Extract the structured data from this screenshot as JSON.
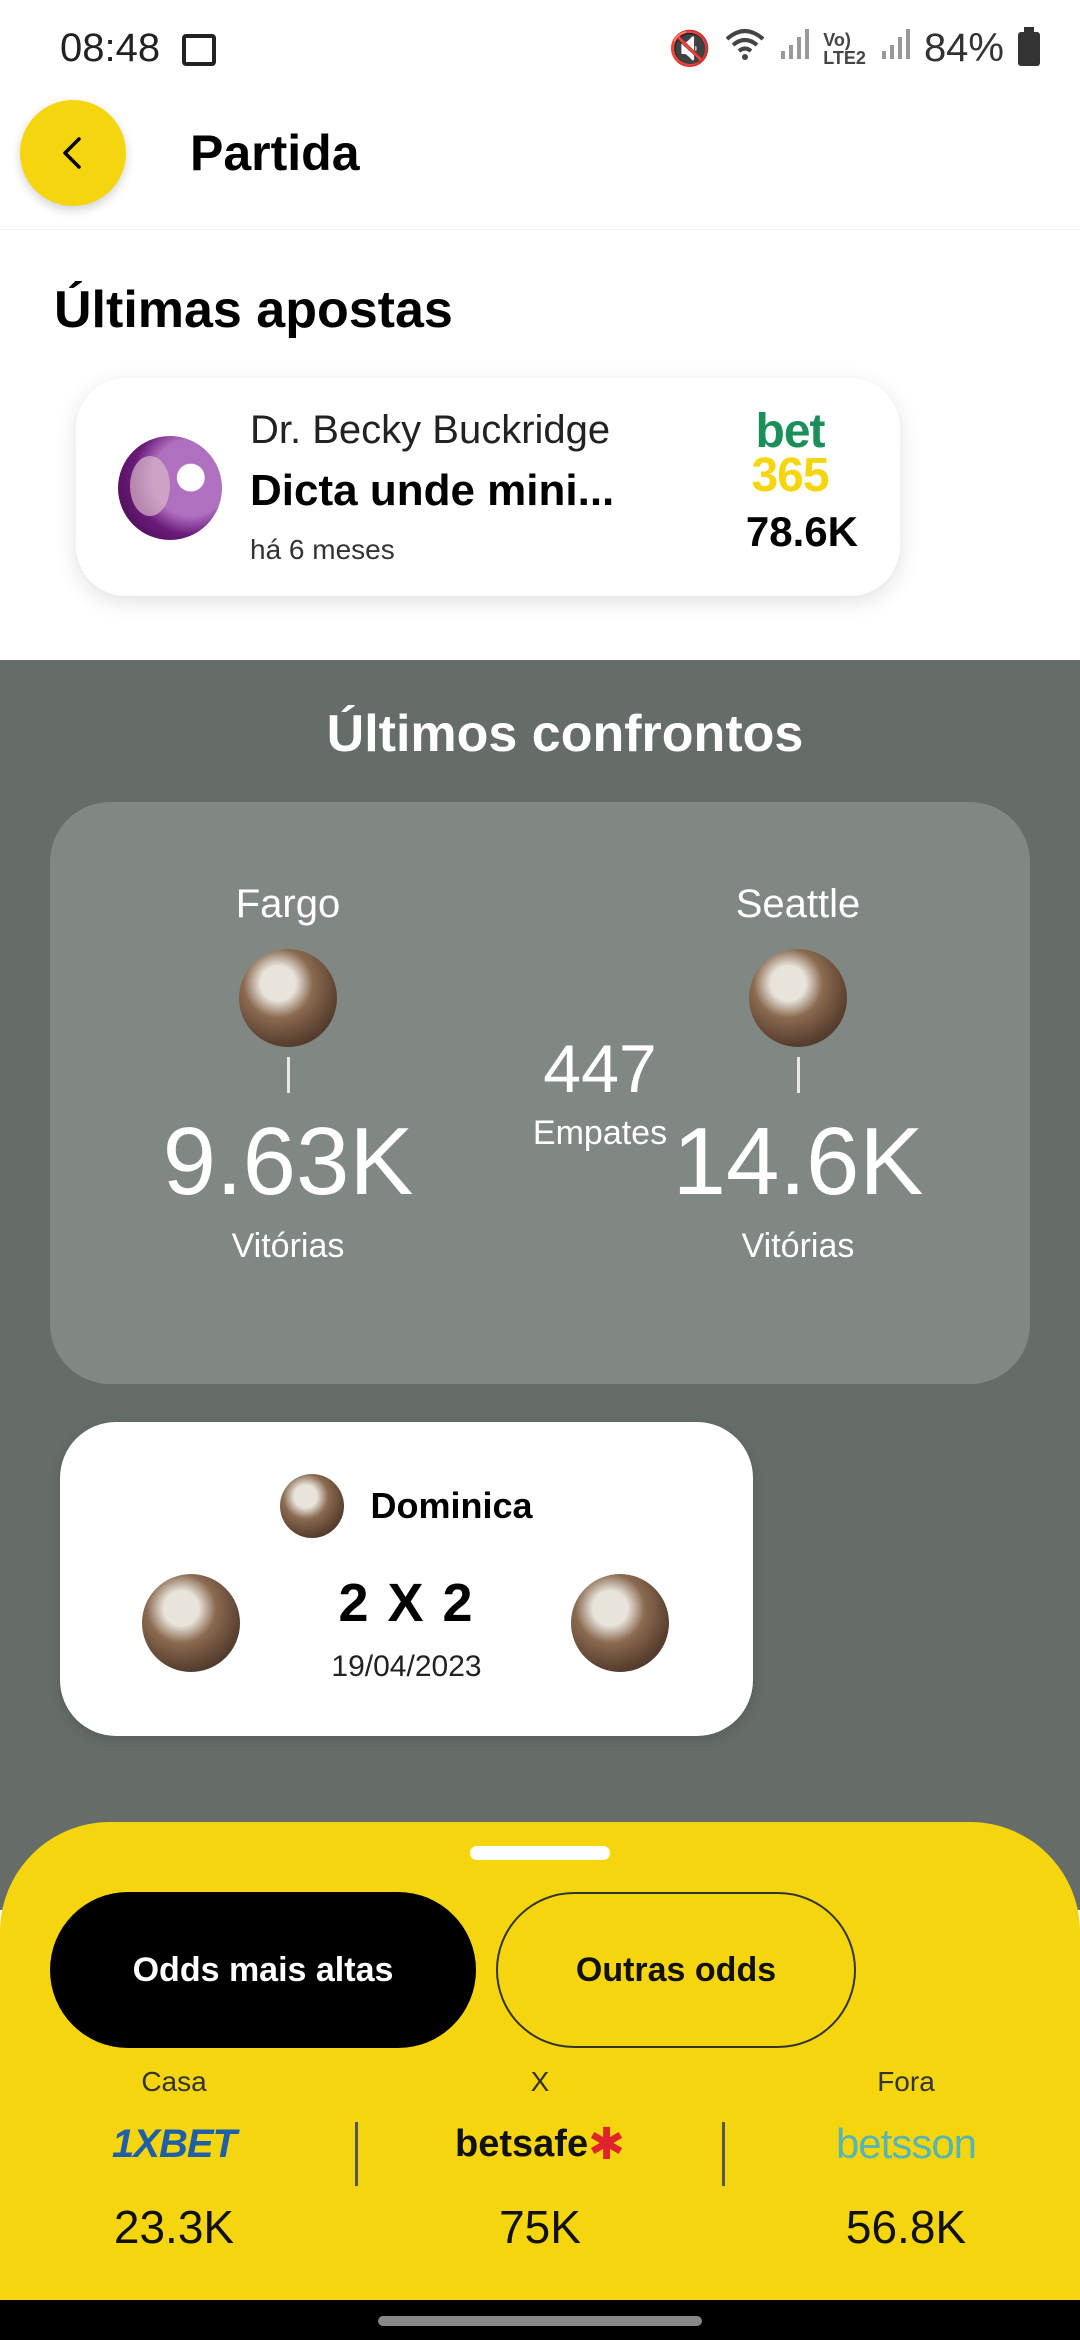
{
  "status_bar": {
    "time": "08:48",
    "battery": "84%",
    "icons": [
      "photo-icon",
      "mute-icon",
      "wifi-icon",
      "signal-icon",
      "volte-icon",
      "signal-icon",
      "battery-icon"
    ]
  },
  "header": {
    "title": "Partida",
    "back_icon": "chevron-left-icon"
  },
  "latest_bets": {
    "title": "Últimas apostas",
    "items": [
      {
        "user": "Dr. Becky Buckridge",
        "title": "Dicta unde mini...",
        "time": "há 6 meses",
        "bookmaker_line1": "bet",
        "bookmaker_line2": "365",
        "value": "78.6K"
      }
    ]
  },
  "confrontations": {
    "title": "Últimos confrontos",
    "home": {
      "name": "Fargo",
      "wins": "9.63K",
      "wins_label": "Vitórias"
    },
    "away": {
      "name": "Seattle",
      "wins": "14.6K",
      "wins_label": "Vitórias"
    },
    "draws": {
      "value": "447",
      "label": "Empates"
    },
    "matches": [
      {
        "league": "Dominica",
        "score": "2 X 2",
        "date": "19/04/2023"
      }
    ]
  },
  "odds": {
    "tabs": [
      {
        "label": "Odds mais altas",
        "active": true
      },
      {
        "label": "Outras odds",
        "active": false
      }
    ],
    "columns": [
      {
        "label": "Casa",
        "bookmaker": "1XBET",
        "value": "23.3K"
      },
      {
        "label": "X",
        "bookmaker": "betsafe",
        "value": "75K"
      },
      {
        "label": "Fora",
        "bookmaker": "betsson",
        "value": "56.8K"
      }
    ]
  },
  "colors": {
    "accent_yellow": "#f5d60e",
    "section_gray": "#666d68",
    "card_gray": "#818884"
  }
}
